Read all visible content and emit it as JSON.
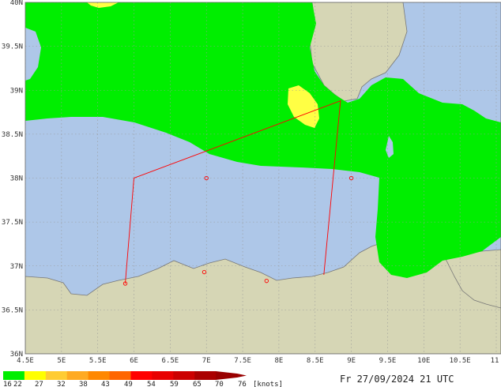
{
  "map": {
    "x_axis": {
      "labels": [
        "4.5E",
        "5E",
        "5.5E",
        "6E",
        "6.5E",
        "7E",
        "7.5E",
        "8E",
        "8.5E",
        "9E",
        "9.5E",
        "10E",
        "10.5E",
        "11"
      ]
    },
    "y_axis": {
      "labels": [
        "40N",
        "39.5N",
        "39N",
        "38.5N",
        "38N",
        "37.5N",
        "37N",
        "36.5N",
        "36N"
      ]
    },
    "colors": {
      "sea": "#aec7e8",
      "land": "#d6d6b5",
      "wind_16_22": "#00ee00",
      "wind_22_27": "#ffff44",
      "route": "#ff0000",
      "coast": "#777777",
      "grid": "#999999"
    },
    "route_points": [
      {
        "lon": 5.88,
        "lat": 36.8
      },
      {
        "lon": 6.0,
        "lat": 38.0
      },
      {
        "lon": 8.85,
        "lat": 38.88
      },
      {
        "lon": 8.62,
        "lat": 36.9
      }
    ],
    "markers": [
      {
        "lon": 5.88,
        "lat": 36.8
      },
      {
        "lon": 7.0,
        "lat": 38.0
      },
      {
        "lon": 6.97,
        "lat": 36.93
      },
      {
        "lon": 7.83,
        "lat": 36.83
      },
      {
        "lon": 9.0,
        "lat": 38.0
      }
    ]
  },
  "legend": {
    "labels": [
      "16",
      "22",
      "27",
      "32",
      "38",
      "43",
      "49",
      "54",
      "59",
      "65",
      "70",
      "76"
    ],
    "unit": "[knots]",
    "colors": [
      "#00ee00",
      "#ffff00",
      "#ffcc33",
      "#ffaa22",
      "#ff8800",
      "#ff6600",
      "#ff0000",
      "#e80000",
      "#cc0000",
      "#aa0000",
      "#990000"
    ]
  },
  "timestamp": "Fr 27/09/2024 21 UTC"
}
